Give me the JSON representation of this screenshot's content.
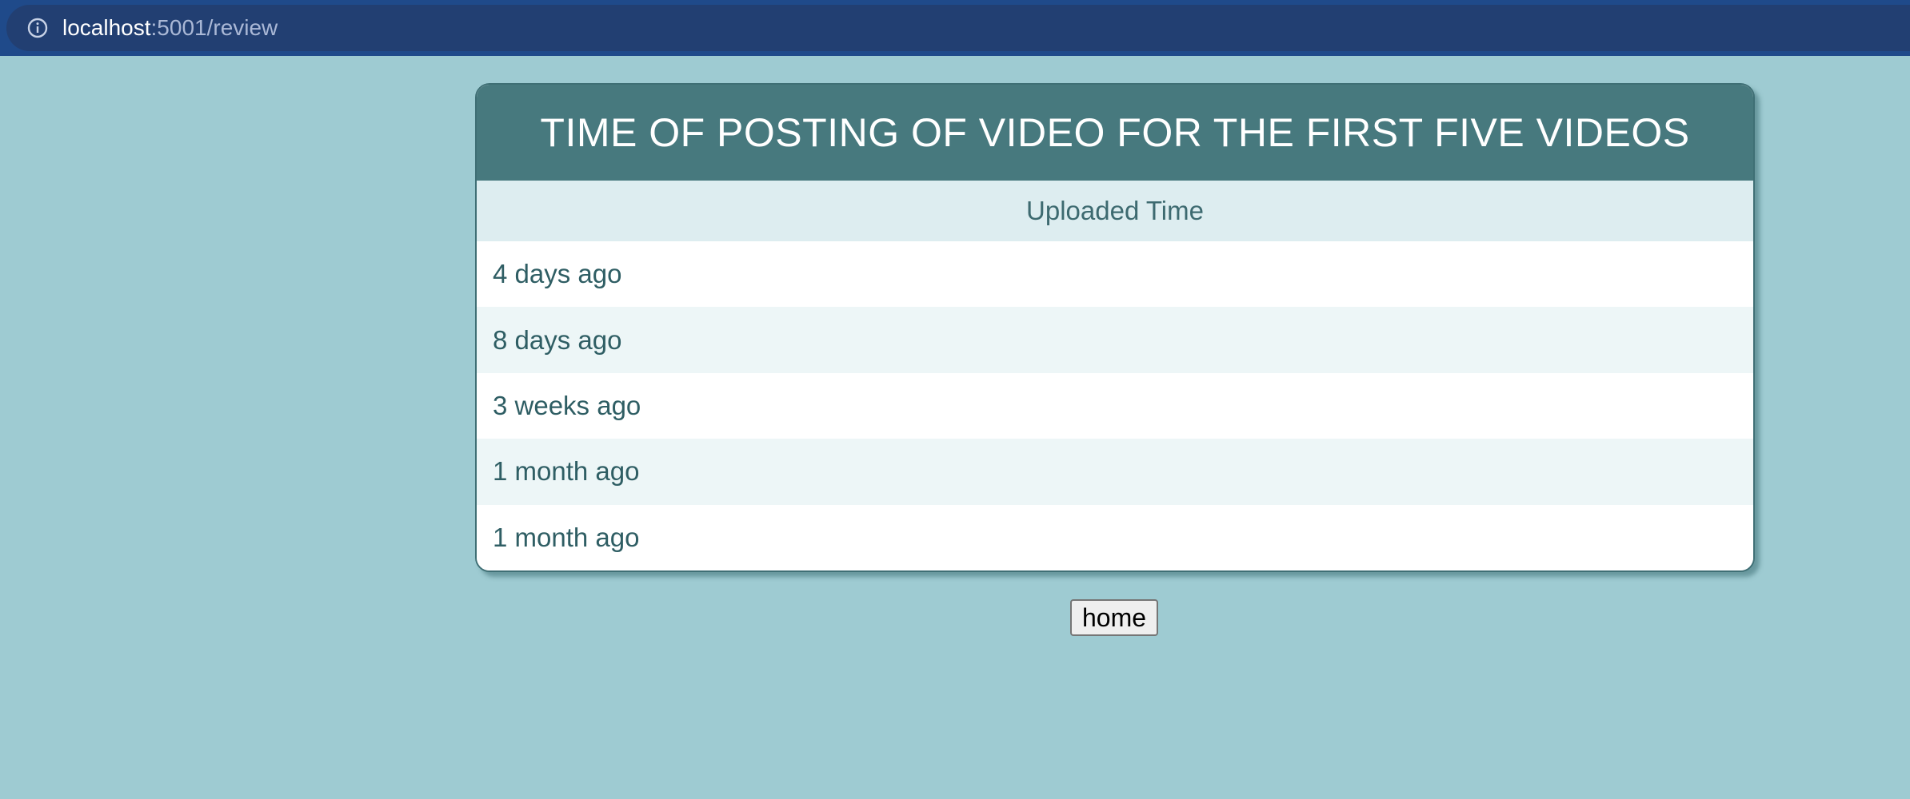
{
  "browser": {
    "url_host": "localhost",
    "url_path": ":5001/review"
  },
  "table": {
    "title": "TIME OF POSTING OF VIDEO FOR THE FIRST FIVE VIDEOS",
    "column_header": "Uploaded Time",
    "rows": [
      "4 days ago",
      "8 days ago",
      "3 weeks ago",
      "1 month ago",
      "1 month ago"
    ]
  },
  "home_button": {
    "label": "home"
  }
}
